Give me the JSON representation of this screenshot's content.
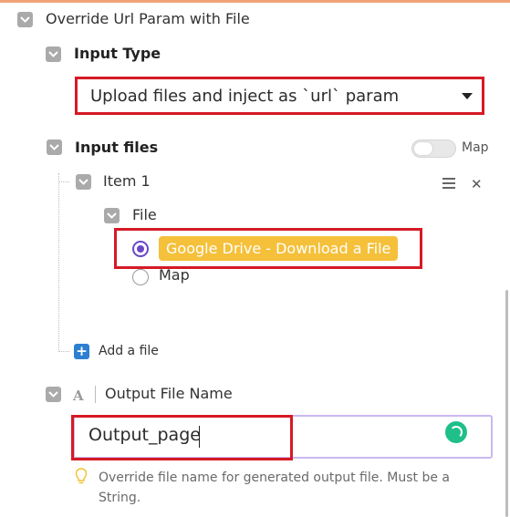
{
  "section": {
    "title": "Override Url Param with File"
  },
  "input_type": {
    "label": "Input Type",
    "selected": "Upload files and inject as `url` param"
  },
  "input_files": {
    "label": "Input files",
    "map_label": "Map",
    "item": {
      "title": "Item 1",
      "file_label": "File",
      "options": [
        {
          "label": "Google Drive - Download a File",
          "selected": true
        },
        {
          "label": "Map",
          "selected": false
        }
      ]
    },
    "add_label": "Add a file"
  },
  "output_file_name": {
    "type_glyph": "A",
    "label": "Output File Name",
    "value": "Output_page",
    "hint": "Override file name for generated output file. Must be a String."
  },
  "colors": {
    "highlight": "#d61a25",
    "selected_pill": "#f5c03a",
    "radio": "#6a48c8",
    "add_button": "#2d7fd1",
    "spinner": "#1fbf8a"
  }
}
